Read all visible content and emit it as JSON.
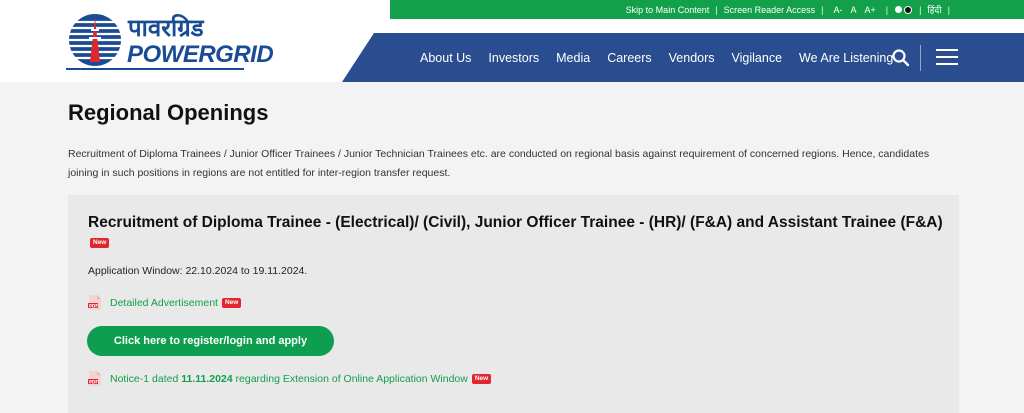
{
  "brand": {
    "hindi_name": "पावरग्रिड",
    "english_name": "POWERGRID"
  },
  "topbar": {
    "skip_link": "Skip to Main Content",
    "screen_reader": "Screen Reader Access",
    "font_small": "A-",
    "font_normal": "A",
    "font_large": "A+",
    "language": "हिंदी"
  },
  "nav": {
    "items": [
      "About Us",
      "Investors",
      "Media",
      "Careers",
      "Vendors",
      "Vigilance",
      "We Are Listening"
    ]
  },
  "page": {
    "title": "Regional Openings",
    "intro": "Recruitment of Diploma Trainees / Junior Officer Trainees / Junior Technician Trainees etc. are conducted on regional basis against requirement of concerned regions. Hence, candidates joining in such positions in regions are not entitled for inter-region transfer request."
  },
  "recruitment": {
    "title": "Recruitment of Diploma Trainee - (Electrical)/ (Civil), Junior Officer Trainee - (HR)/ (F&A) and Assistant Trainee (F&A)",
    "new_badge": "New",
    "application_window": "Application Window: 22.10.2024 to 19.11.2024.",
    "detailed_ad": "Detailed Advertisement",
    "apply_button": "Click here to register/login and apply",
    "notice_prefix": "Notice-1 dated ",
    "notice_date": "11.11.2024",
    "notice_suffix": " regarding Extension of Online Application Window",
    "pdf_icon_label": "PDF"
  },
  "colors": {
    "green": "#13a04b",
    "navy": "#2a4d8f",
    "brand_blue": "#1a4c96",
    "badge_red": "#e0272f"
  },
  "icons": [
    "powergrid-globe-logo",
    "search-icon",
    "hamburger-menu-icon",
    "pdf-icon"
  ]
}
